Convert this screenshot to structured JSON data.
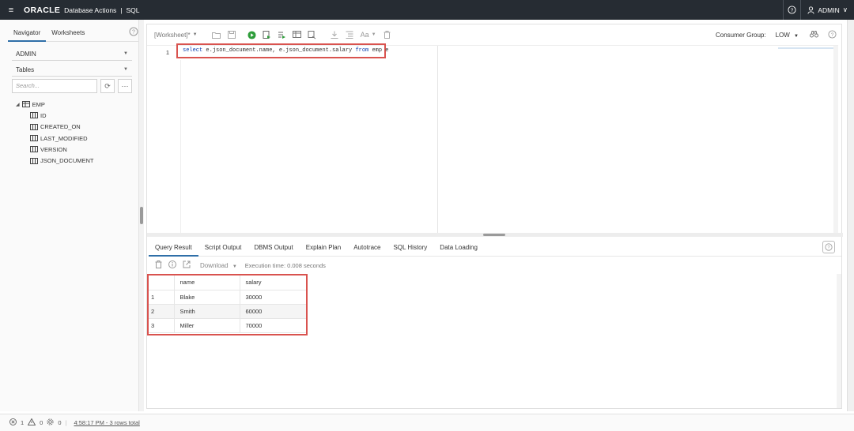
{
  "topbar": {
    "menu_icon": "hamburger-icon",
    "logo": "ORACLE",
    "app_name": "Database Actions",
    "separator": "|",
    "section": "SQL",
    "user": "ADMIN"
  },
  "navigator": {
    "tabs": [
      "Navigator",
      "Worksheets"
    ],
    "schema": "ADMIN",
    "object_type": "Tables",
    "search_placeholder": "Search...",
    "tree": {
      "table": "EMP",
      "columns": [
        "ID",
        "CREATED_ON",
        "LAST_MODIFIED",
        "VERSION",
        "JSON_DOCUMENT"
      ]
    }
  },
  "worksheet": {
    "title": "[Worksheet]*",
    "consumer_group_label": "Consumer Group:",
    "consumer_group_value": "LOW",
    "font_size_label": "Aa",
    "line_number": "1",
    "code": {
      "kw1": "select",
      "mid": " e.json_document.name, e.json_document.salary ",
      "kw2": "from",
      "tail": " emp e"
    }
  },
  "results": {
    "tabs": [
      "Query Result",
      "Script Output",
      "DBMS Output",
      "Explain Plan",
      "Autotrace",
      "SQL History",
      "Data Loading"
    ],
    "download_label": "Download",
    "execution_time": "Execution time: 0.008 seconds",
    "columns": [
      "name",
      "salary"
    ],
    "rows": [
      {
        "n": "1",
        "name": "Blake",
        "salary": "30000"
      },
      {
        "n": "2",
        "name": "Smith",
        "salary": "60000"
      },
      {
        "n": "3",
        "name": "Miller",
        "salary": "70000"
      }
    ]
  },
  "status": {
    "errors": "1",
    "warnings": "0",
    "tasks": "0",
    "message": "4:58:17 PM - 3 rows total"
  },
  "colors": {
    "topbar_bg": "#262c33",
    "highlight_red": "#d9534f",
    "run_green": "#2e9d3a",
    "tab_active": "#2f6fa8"
  }
}
